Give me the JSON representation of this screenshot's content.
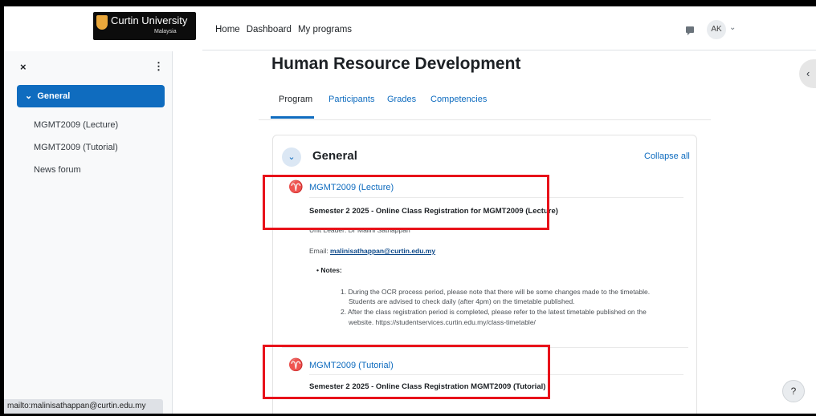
{
  "brand": {
    "name": "Curtin University",
    "sub": "Malaysia"
  },
  "nav": {
    "home": "Home",
    "dashboard": "Dashboard",
    "programs": "My programs"
  },
  "user": {
    "initials": "AK",
    "caret": "⌄"
  },
  "drawer": {
    "close": "×",
    "menu": "⋮",
    "active_item": "General",
    "items": [
      "MGMT2009 (Lecture)",
      "MGMT2009 (Tutorial)",
      "News forum"
    ]
  },
  "page": {
    "title": "Human Resource Development",
    "tabs": [
      "Program",
      "Participants",
      "Grades",
      "Competencies"
    ]
  },
  "section": {
    "toggle": "⌄",
    "title": "General",
    "collapse_all": "Collapse all"
  },
  "activities": [
    {
      "link": "MGMT2009 (Lecture)",
      "heading": "Semester 2 2025 - Online Class Registration for MGMT2009 (Lecture)"
    },
    {
      "link": "MGMT2009 (Tutorial)",
      "heading": "Semester 2 2025 - Online Class Registration MGMT2009 (Tutorial)"
    }
  ],
  "details": {
    "unit_leader": "Unit Leader: Dr Malini Sathappan",
    "email_label": "Email: ",
    "email": "malinisathappan@curtin.edu.my",
    "notes_label": "•  Notes:",
    "note1a": "1. During the OCR process period, please note that there will be some changes made to the timetable.",
    "note1b": "Students are advised to check daily (after 4pm) on the timetable published.",
    "note2a": "2. After the class registration period is completed, please refer to the latest timetable published on the",
    "note2b": "website. https://studentservices.curtin.edu.my/class-timetable/"
  },
  "statusbar": "mailto:malinisathappan@curtin.edu.my",
  "help": "?",
  "right_drawer_toggle": "‹",
  "colors": {
    "accent": "#0f6cbf",
    "highlight": "#e8121a",
    "activity_icon": "#d86b1e"
  }
}
